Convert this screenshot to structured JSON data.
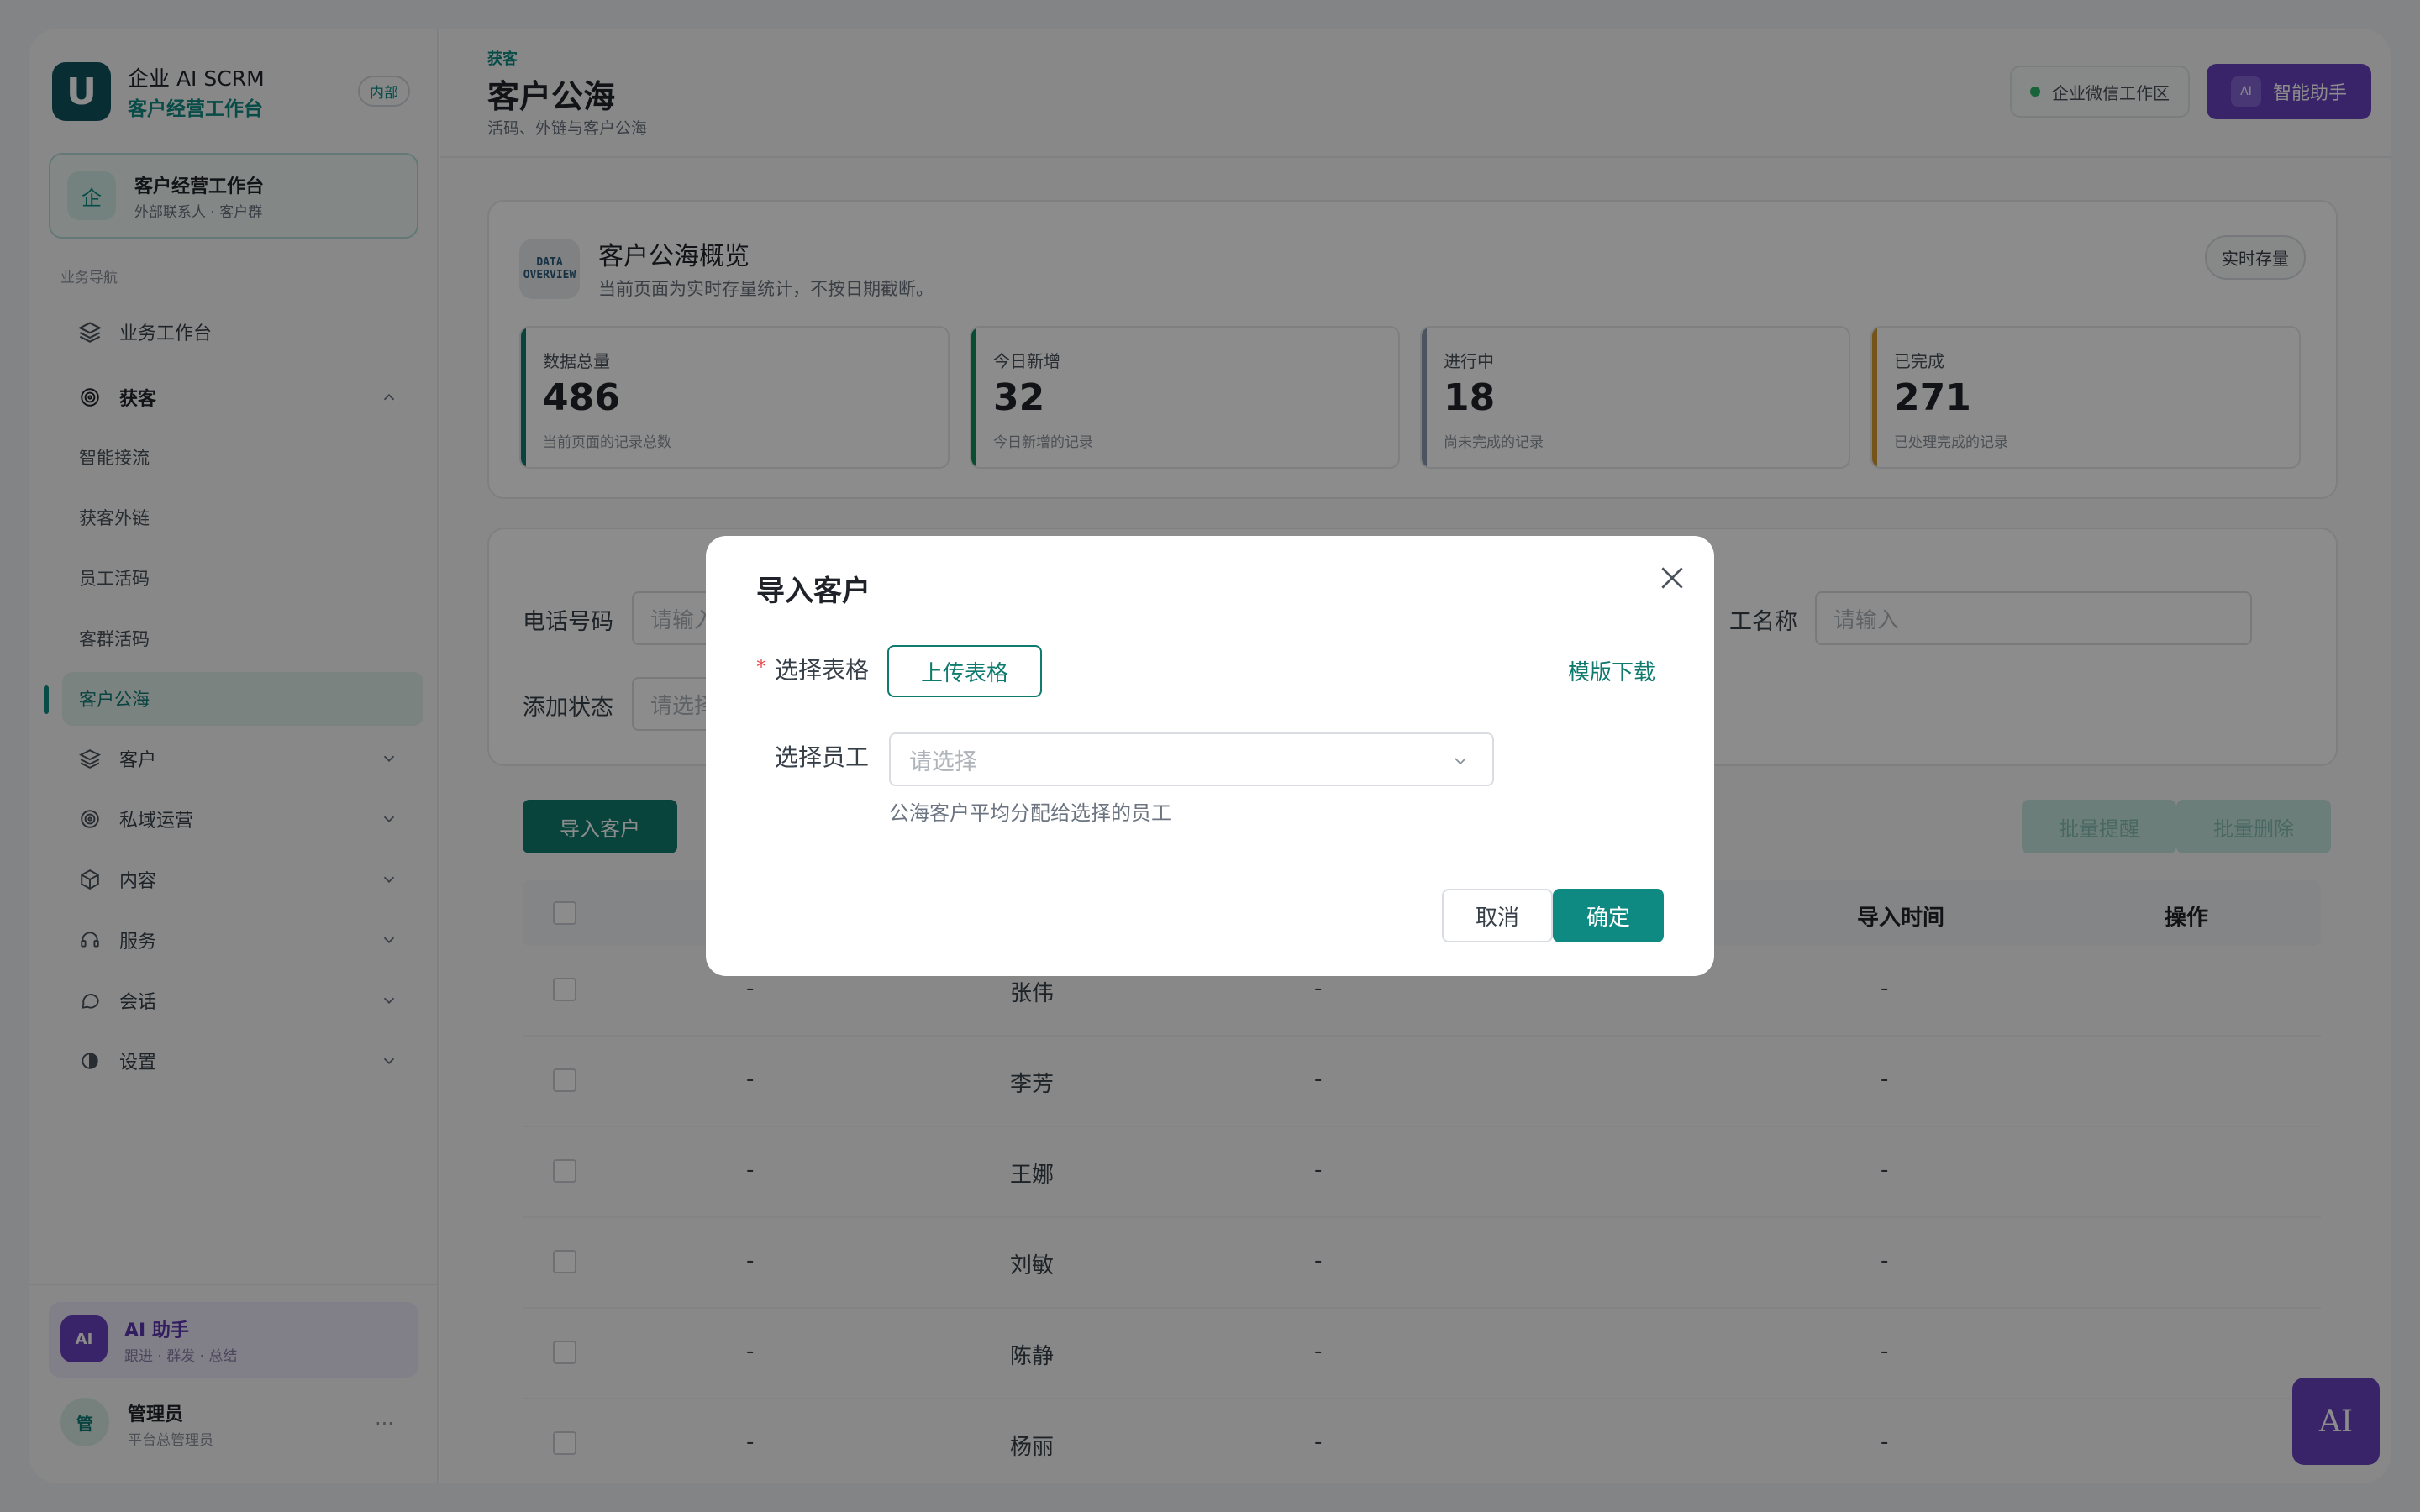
{
  "brand": {
    "logo": "U",
    "name": "企业 AI SCRM",
    "sub": "客户经营工作台",
    "badge": "内部"
  },
  "workspace": {
    "icon": "企",
    "title": "客户经营工作台",
    "sub": "外部联系人 · 客户群"
  },
  "nav": {
    "section": "业务导航",
    "workbench": "业务工作台",
    "acquire": "获客",
    "acquire_items": [
      "智能接流",
      "获客外链",
      "员工活码",
      "客群活码",
      "客户公海"
    ],
    "groups": [
      "客户",
      "私域运营",
      "内容",
      "服务",
      "会话",
      "设置"
    ]
  },
  "ai_card": {
    "avatar": "AI",
    "title": "AI 助手",
    "sub": "跟进 · 群发 · 总结"
  },
  "user": {
    "avatar": "管",
    "name": "管理员",
    "role": "平台总管理员",
    "more": "..."
  },
  "header": {
    "crumb": "获客",
    "title": "客户公海",
    "sub": "活码、外链与客户公海",
    "wx": "企业微信工作区",
    "assist_icon": "AI",
    "assist": "智能助手"
  },
  "overview": {
    "icon": "DATA\nOVERVIEW",
    "title": "客户公海概览",
    "sub": "当前页面为实时存量统计，不按日期截断。",
    "tag": "实时存量",
    "stats": [
      {
        "label": "数据总量",
        "value": "486",
        "desc": "当前页面的记录总数",
        "color": "#0f7a6e"
      },
      {
        "label": "今日新增",
        "value": "32",
        "desc": "今日新增的记录",
        "color": "#0f8a5a"
      },
      {
        "label": "进行中",
        "value": "18",
        "desc": "尚未完成的记录",
        "color": "#8a9ab0"
      },
      {
        "label": "已完成",
        "value": "271",
        "desc": "已处理完成的记录",
        "color": "#d39a2c"
      }
    ]
  },
  "filters": {
    "phone_label": "电话号码",
    "phone_ph": "请输入",
    "status_label": "添加状态",
    "status_ph": "请选择",
    "staff_label": "员工名称",
    "staff_label_visible": "工名称",
    "staff_ph": "请输入"
  },
  "actions": {
    "import": "导入客户",
    "bulk_remind": "批量提醒",
    "bulk_delete": "批量删除"
  },
  "table": {
    "columns": [
      "导入时间",
      "操作"
    ],
    "rows": [
      {
        "c1": "-",
        "name": "张伟",
        "c3": "-",
        "time": "-"
      },
      {
        "c1": "-",
        "name": "李芳",
        "c3": "-",
        "time": "-"
      },
      {
        "c1": "-",
        "name": "王娜",
        "c3": "-",
        "time": "-"
      },
      {
        "c1": "-",
        "name": "刘敏",
        "c3": "-",
        "time": "-"
      },
      {
        "c1": "-",
        "name": "陈静",
        "c3": "-",
        "time": "-"
      },
      {
        "c1": "-",
        "name": "杨丽",
        "c3": "-",
        "time": "-"
      }
    ]
  },
  "float_ai": "AI",
  "modal": {
    "title": "导入客户",
    "required_mark": "*",
    "sheet_label": "选择表格",
    "upload": "上传表格",
    "template": "模版下载",
    "staff_label": "选择员工",
    "staff_placeholder": "请选择",
    "hint": "公海客户平均分配给选择的员工",
    "cancel": "取消",
    "ok": "确定"
  }
}
